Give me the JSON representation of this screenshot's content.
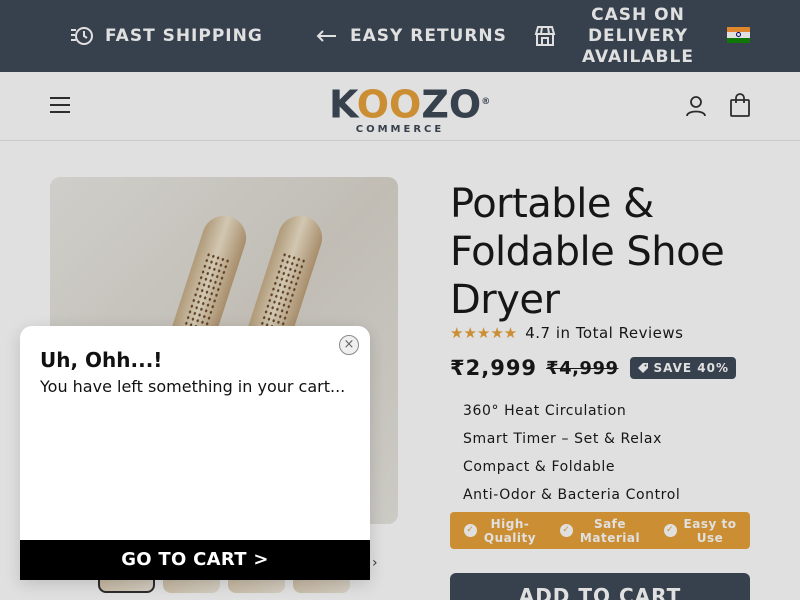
{
  "announcement": {
    "shipping": "FAST SHIPPING",
    "returns": "EASY RETURNS",
    "cod_line1": "CASH ON",
    "cod_line2": "DELIVERY",
    "cod_line3": "AVAILABLE",
    "flag_colors": [
      "#ff9933",
      "#ffffff",
      "#138808"
    ]
  },
  "header": {
    "logo_k": "K",
    "logo_oo": "OO",
    "logo_zo": "ZO",
    "logo_registered": "®",
    "logo_sub": "COMMERCE",
    "icons": [
      "menu-icon",
      "account-icon",
      "cart-icon"
    ]
  },
  "product": {
    "title": "Portable & Foldable Shoe Dryer",
    "stars": "★★★★★",
    "rating_text": "4.7 in Total Reviews",
    "price": "₹2,999",
    "compare_price": "₹4,999",
    "save_label": "SAVE 40%",
    "features": [
      "360° Heat Circulation",
      "Smart Timer – Set & Relax",
      "Compact & Foldable",
      "Anti-Odor & Bacteria Control"
    ],
    "trust": [
      {
        "line1": "High-",
        "line2": "Quality"
      },
      {
        "line1": "Safe",
        "line2": "Material"
      },
      {
        "line1": "Easy to",
        "line2": "Use"
      }
    ],
    "add_to_cart": "ADD TO CART",
    "thumb_next": "›"
  },
  "popup": {
    "title": "Uh, Ohh...!",
    "message": "You have left something in your cart...",
    "cta": "GO TO CART >",
    "close": "×"
  },
  "colors": {
    "brand_dark": "#3f4a59",
    "accent": "#e9a23b"
  }
}
